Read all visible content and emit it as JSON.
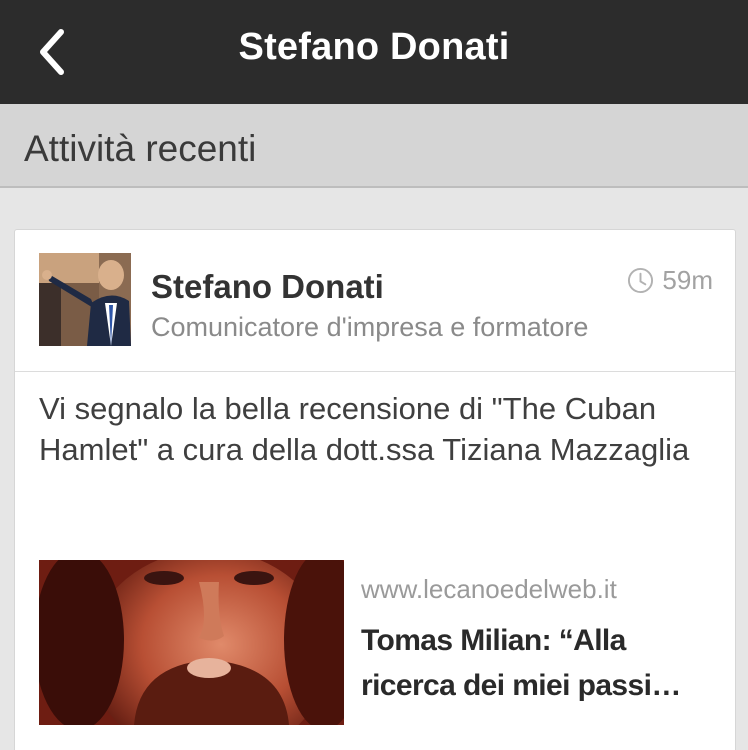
{
  "header": {
    "title": "Stefano Donati"
  },
  "section": {
    "title": "Attività recenti"
  },
  "post": {
    "author": "Stefano Donati",
    "role": "Comunicatore d'impresa e formatore",
    "time": "59m",
    "text": "Vi segnalo la bella recensione di \"The Cuban Hamlet\" a cura della dott.ssa Tiziana Mazzaglia",
    "link": {
      "domain": "www.lecanoedelweb.it",
      "title_line1": "Tomas Milian: “Alla",
      "title_line2": "ricerca dei miei passi…"
    }
  },
  "icons": {
    "back": "chevron-left-icon",
    "clock": "clock-icon"
  }
}
